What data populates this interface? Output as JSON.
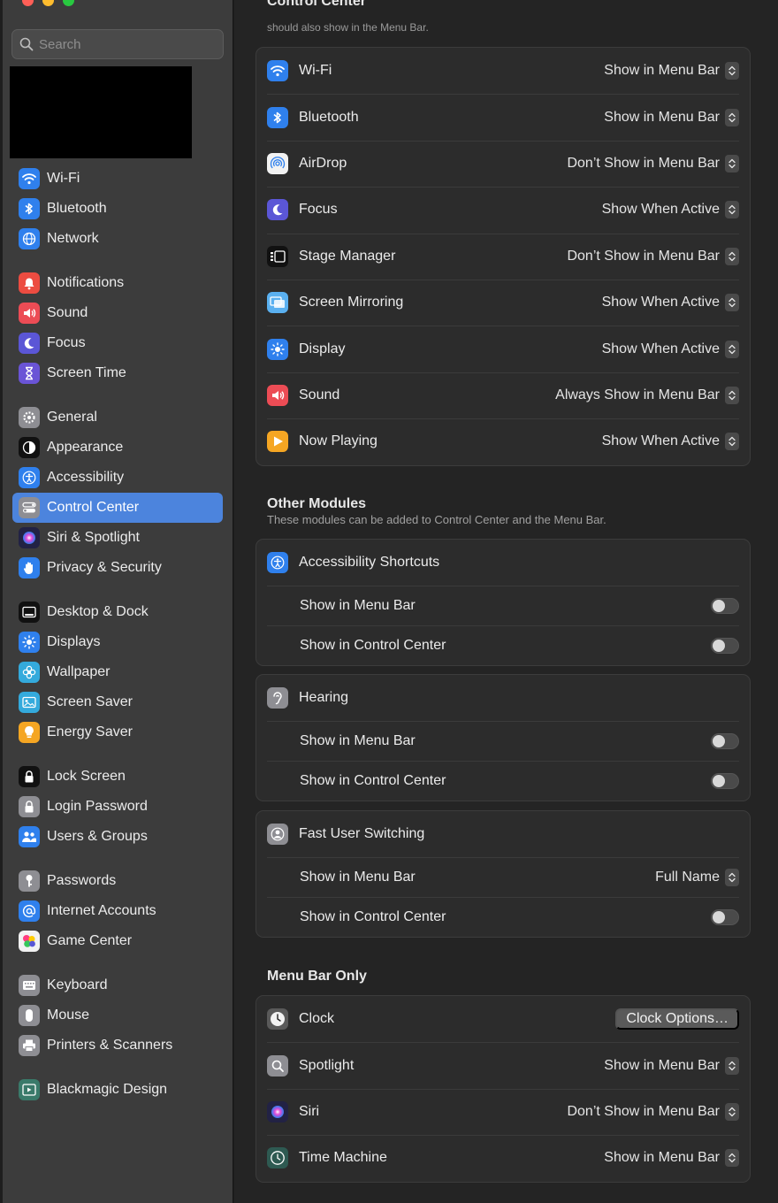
{
  "sidebar": {
    "search_placeholder": "Search",
    "groups": [
      [
        {
          "label": "Wi-Fi",
          "icon": "wifi-icon",
          "color": "#2f80ed"
        },
        {
          "label": "Bluetooth",
          "icon": "bluetooth-icon",
          "color": "#2f80ed"
        },
        {
          "label": "Network",
          "icon": "globe-icon",
          "color": "#2f80ed"
        }
      ],
      [
        {
          "label": "Notifications",
          "icon": "bell-icon",
          "color": "#ec4c41"
        },
        {
          "label": "Sound",
          "icon": "speaker-icon",
          "color": "#ec4c55"
        },
        {
          "label": "Focus",
          "icon": "moon-icon",
          "color": "#5b56d6"
        },
        {
          "label": "Screen Time",
          "icon": "hourglass-icon",
          "color": "#6a54d6"
        }
      ],
      [
        {
          "label": "General",
          "icon": "gear-icon",
          "color": "#8e8e93"
        },
        {
          "label": "Appearance",
          "icon": "appearance-icon",
          "color": "#111111"
        },
        {
          "label": "Accessibility",
          "icon": "accessibility-icon",
          "color": "#2f80ed"
        },
        {
          "label": "Control Center",
          "icon": "control-center-icon",
          "color": "#8e8e93",
          "active": true
        },
        {
          "label": "Siri & Spotlight",
          "icon": "siri-icon",
          "color": "#222244"
        },
        {
          "label": "Privacy & Security",
          "icon": "hand-icon",
          "color": "#2f80ed"
        }
      ],
      [
        {
          "label": "Desktop & Dock",
          "icon": "dock-icon",
          "color": "#111111"
        },
        {
          "label": "Displays",
          "icon": "sun-icon",
          "color": "#2f80ed"
        },
        {
          "label": "Wallpaper",
          "icon": "flower-icon",
          "color": "#34aadc"
        },
        {
          "label": "Screen Saver",
          "icon": "screen-saver-icon",
          "color": "#34aadc"
        },
        {
          "label": "Energy Saver",
          "icon": "lightbulb-icon",
          "color": "#f5a623"
        }
      ],
      [
        {
          "label": "Lock Screen",
          "icon": "lock-screen-icon",
          "color": "#111111"
        },
        {
          "label": "Login Password",
          "icon": "lock-icon",
          "color": "#8e8e93"
        },
        {
          "label": "Users & Groups",
          "icon": "users-icon",
          "color": "#2f80ed"
        }
      ],
      [
        {
          "label": "Passwords",
          "icon": "key-icon",
          "color": "#8e8e93"
        },
        {
          "label": "Internet Accounts",
          "icon": "at-icon",
          "color": "#2f80ed"
        },
        {
          "label": "Game Center",
          "icon": "game-center-icon",
          "color": "#f2f2f2"
        }
      ],
      [
        {
          "label": "Keyboard",
          "icon": "keyboard-icon",
          "color": "#8e8e93"
        },
        {
          "label": "Mouse",
          "icon": "mouse-icon",
          "color": "#8e8e93"
        },
        {
          "label": "Printers & Scanners",
          "icon": "printer-icon",
          "color": "#8e8e93"
        }
      ],
      [
        {
          "label": "Blackmagic Design",
          "icon": "blackmagic-icon",
          "color": "#3a7a6a"
        }
      ]
    ]
  },
  "main": {
    "title": "Control Center",
    "subtitle": "should also show in the Menu Bar.",
    "control_center_modules": [
      {
        "label": "Wi-Fi",
        "value": "Show in Menu Bar",
        "icon": "wifi-icon",
        "color": "#2f80ed"
      },
      {
        "label": "Bluetooth",
        "value": "Show in Menu Bar",
        "icon": "bluetooth-icon",
        "color": "#2f80ed"
      },
      {
        "label": "AirDrop",
        "value": "Don’t Show in Menu Bar",
        "icon": "airdrop-icon",
        "color": "#f2f2f2"
      },
      {
        "label": "Focus",
        "value": "Show When Active",
        "icon": "moon-icon",
        "color": "#5b56d6"
      },
      {
        "label": "Stage Manager",
        "value": "Don’t Show in Menu Bar",
        "icon": "stage-manager-icon",
        "color": "#111111"
      },
      {
        "label": "Screen Mirroring",
        "value": "Show When Active",
        "icon": "screen-mirroring-icon",
        "color": "#5ab0f0"
      },
      {
        "label": "Display",
        "value": "Show When Active",
        "icon": "sun-icon",
        "color": "#2f80ed"
      },
      {
        "label": "Sound",
        "value": "Always Show in Menu Bar",
        "icon": "speaker-icon",
        "color": "#ec4c55"
      },
      {
        "label": "Now Playing",
        "value": "Show When Active",
        "icon": "play-icon",
        "color": "#f5a623"
      }
    ],
    "other_modules": {
      "title": "Other Modules",
      "subtitle": "These modules can be added to Control Center and the Menu Bar.",
      "modules": [
        {
          "label": "Accessibility Shortcuts",
          "icon": "accessibility-icon",
          "color": "#2f80ed",
          "menu_bar_label": "Show in Menu Bar",
          "control_center_label": "Show in Control Center"
        },
        {
          "label": "Hearing",
          "icon": "ear-icon",
          "color": "#8e8e93",
          "menu_bar_label": "Show in Menu Bar",
          "control_center_label": "Show in Control Center"
        },
        {
          "label": "Fast User Switching",
          "icon": "user-circle-icon",
          "color": "#8e8e93",
          "menu_bar_label": "Show in Menu Bar",
          "menu_bar_value": "Full Name",
          "control_center_label": "Show in Control Center"
        }
      ]
    },
    "menu_bar_only": {
      "title": "Menu Bar Only",
      "clock": {
        "label": "Clock",
        "button": "Clock Options…",
        "icon": "clock-icon"
      },
      "items": [
        {
          "label": "Spotlight",
          "value": "Show in Menu Bar",
          "icon": "magnifier-icon",
          "color": "#8e8e93"
        },
        {
          "label": "Siri",
          "value": "Don’t Show in Menu Bar",
          "icon": "siri-icon",
          "color": "#222244"
        },
        {
          "label": "Time Machine",
          "value": "Show in Menu Bar",
          "icon": "time-machine-icon",
          "color": "#2e5a52"
        }
      ]
    }
  }
}
